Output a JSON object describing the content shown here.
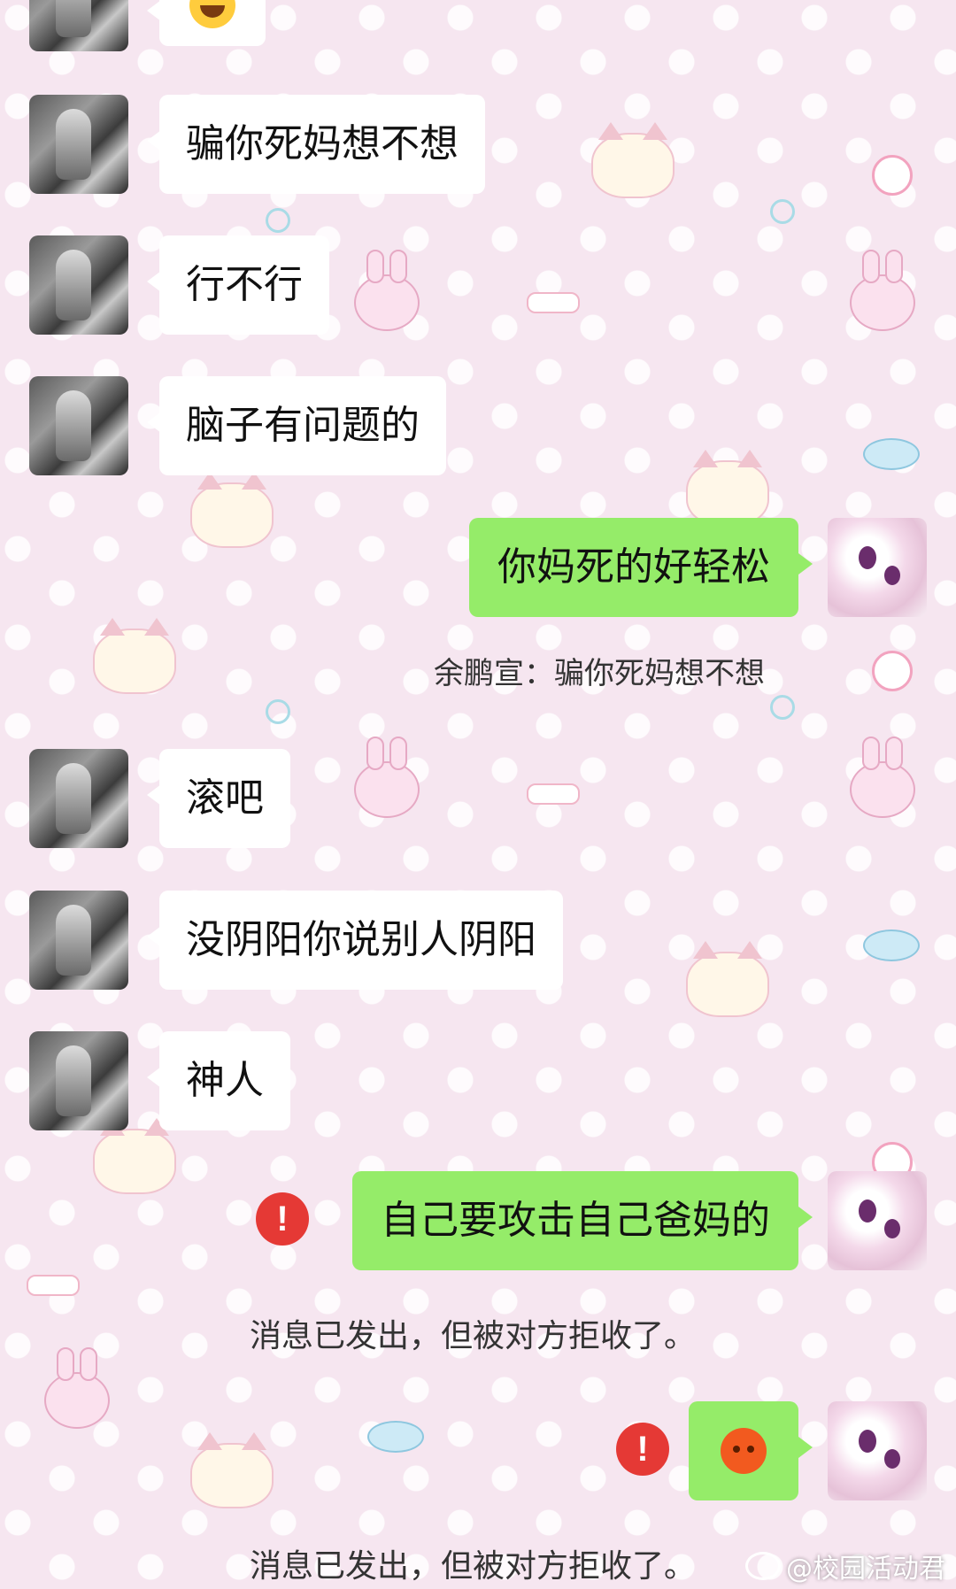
{
  "messages": [
    {
      "from": "other",
      "text": "骗你死妈想不想"
    },
    {
      "from": "other",
      "text": "行不行"
    },
    {
      "from": "other",
      "text": "脑子有问题的"
    },
    {
      "from": "me",
      "text": "你妈死的好轻松"
    },
    {
      "from": "other",
      "text": "滚吧"
    },
    {
      "from": "other",
      "text": "没阴阳你说别人阴阳"
    },
    {
      "from": "other",
      "text": "神人"
    },
    {
      "from": "me",
      "text": "自己要攻击自己爸妈的",
      "status": "rejected"
    },
    {
      "from": "me",
      "emoji": "angry-sweat-face-emoji",
      "status": "rejected"
    }
  ],
  "quote": {
    "sender": "余鹏宣",
    "separator": "：",
    "text": "骗你死妈想不想"
  },
  "reject_note": "消息已发出，但被对方拒收了。",
  "error_icon_symbol": "!",
  "top_emoji": "laughing-tears-emoji",
  "watermark": "@校园活动君",
  "colors": {
    "incoming_bubble": "#ffffff",
    "outgoing_bubble": "#95ec69",
    "error": "#e53935"
  }
}
